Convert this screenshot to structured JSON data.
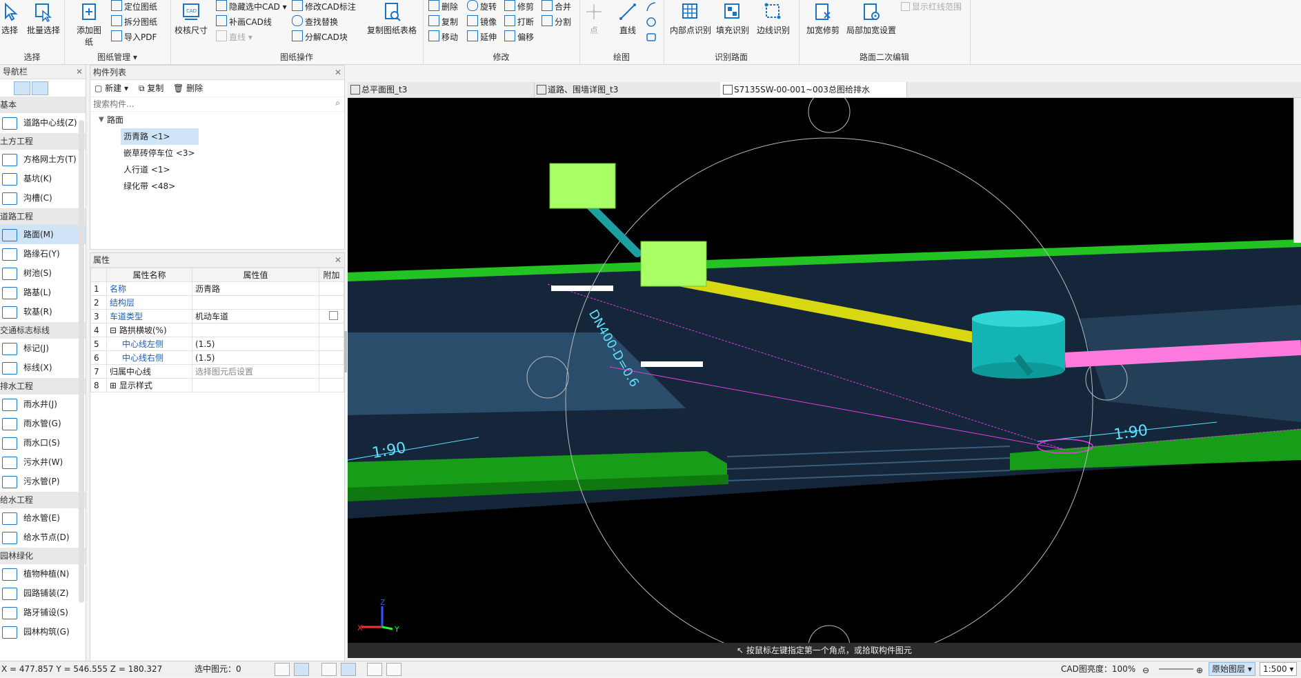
{
  "ribbon": {
    "groups": [
      {
        "label": "选择",
        "buttons": [
          "选择",
          "批量选择"
        ]
      },
      {
        "label": "图纸管理",
        "big": "添加图纸",
        "small": [
          "定位图纸",
          "拆分图纸",
          "导入PDF"
        ]
      },
      {
        "label": "图纸操作",
        "big": "校核尺寸",
        "small": [
          "隐藏选中CAD",
          "补画CAD线",
          "直线",
          "修改CAD标注",
          "查找替换",
          "分解CAD块"
        ],
        "big2": "复制图纸表格"
      },
      {
        "label": "修改",
        "small": [
          "删除",
          "旋转",
          "修剪",
          "合并",
          "复制",
          "镜像",
          "打断",
          "分割",
          "移动",
          "延伸",
          "偏移"
        ]
      },
      {
        "label": "绘图",
        "small": [
          "点",
          "直线"
        ]
      },
      {
        "label": "识别路面",
        "buttons": [
          "内部点识别",
          "填充识别",
          "边线识别"
        ]
      },
      {
        "label": "路面二次编辑",
        "buttons": [
          "加宽修剪",
          "局部加宽设置"
        ],
        "checkbox": "显示红线范围"
      }
    ]
  },
  "leftnav": {
    "title": "导航栏",
    "categories": [
      {
        "name": "基本",
        "items": [
          "道路中心线(Z)"
        ]
      },
      {
        "name": "土方工程",
        "items": [
          "方格网土方(T)",
          "基坑(K)",
          "沟槽(C)"
        ]
      },
      {
        "name": "道路工程",
        "items": [
          "路面(M)",
          "路缘石(Y)",
          "树池(S)",
          "路基(L)",
          "软基(R)"
        ]
      },
      {
        "name": "交通标志标线",
        "items": [
          "标记(J)",
          "标线(X)"
        ]
      },
      {
        "name": "排水工程",
        "items": [
          "雨水井(J)",
          "雨水管(G)",
          "雨水口(S)",
          "污水井(W)",
          "污水管(P)"
        ]
      },
      {
        "name": "给水工程",
        "items": [
          "给水管(E)",
          "给水节点(D)"
        ]
      },
      {
        "name": "园林绿化",
        "items": [
          "植物种植(N)",
          "园路铺装(Z)",
          "路牙铺设(S)",
          "园林构筑(G)"
        ]
      }
    ]
  },
  "complist": {
    "title": "构件列表",
    "new": "新建",
    "copy": "复制",
    "delete": "删除",
    "search_placeholder": "搜索构件...",
    "tree_root": "路面",
    "items": [
      "沥青路 <1>",
      "嵌草砖停车位 <3>",
      "人行道 <1>",
      "绿化带 <48>"
    ]
  },
  "props": {
    "title": "属性",
    "headers": [
      "属性名称",
      "属性值",
      "附加"
    ],
    "rows": [
      {
        "n": "1",
        "name": "名称",
        "value": "沥青路"
      },
      {
        "n": "2",
        "name": "结构层",
        "value": ""
      },
      {
        "n": "3",
        "name": "车道类型",
        "value": "机动车道"
      },
      {
        "n": "4",
        "name": "路拱横坡(%)",
        "value": ""
      },
      {
        "n": "5",
        "name": "中心线左侧",
        "value": "(1.5)"
      },
      {
        "n": "6",
        "name": "中心线右侧",
        "value": "(1.5)"
      },
      {
        "n": "7",
        "name": "归属中心线",
        "value": "选择图元后设置"
      },
      {
        "n": "8",
        "name": "显示样式",
        "value": ""
      }
    ]
  },
  "tabs": [
    "总平面图_t3",
    "道路、围墙详图_t3",
    "S7135SW-00-001~003总图给排水"
  ],
  "viewport": {
    "annotations": [
      "1:90",
      "1:90",
      "DN400-D=0.6"
    ],
    "axes": {
      "x": "X",
      "y": "Y",
      "z": "Z"
    }
  },
  "cmdbar": "按鼠标左键指定第一个角点，或拾取构件图元",
  "status": {
    "coords": "X = 477.857 Y = 546.555 Z = 180.327",
    "selected": "选中图元：0",
    "cad_brightness": "CAD图亮度：100%",
    "layer": "原始图层",
    "scale": "1:500"
  },
  "colors": {
    "accent": "#1a5fb4",
    "selection": "#cfe4f7",
    "road_green": "#22c322",
    "pipe_yellow": "#d8d812",
    "pipe_pink": "#ff7adf",
    "well_cyan": "#14b4b4"
  }
}
